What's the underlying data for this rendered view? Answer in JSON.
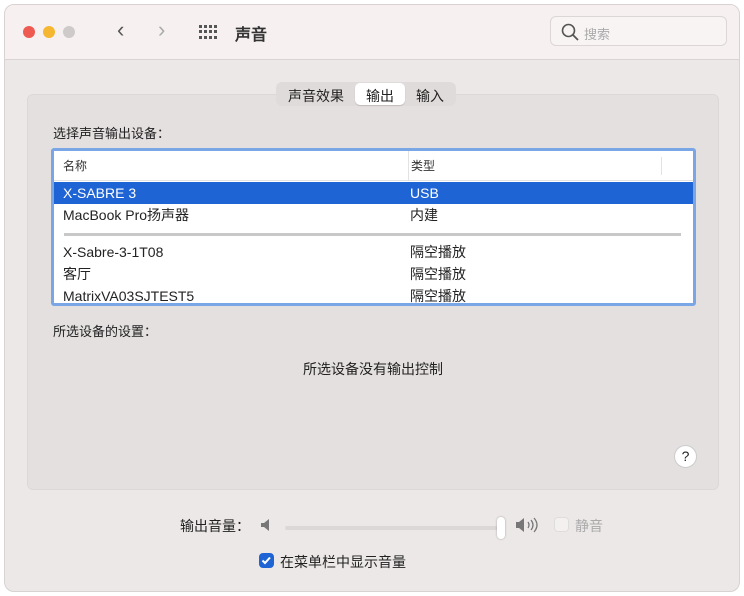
{
  "window": {
    "title": "声音",
    "search_placeholder": "搜索"
  },
  "tabs": [
    {
      "label": "声音效果",
      "selected": false
    },
    {
      "label": "输出",
      "selected": true
    },
    {
      "label": "输入",
      "selected": false
    }
  ],
  "output": {
    "section_label": "选择声音输出设备：",
    "columns": [
      "名称",
      "类型"
    ],
    "devices": [
      {
        "name": "X-SABRE 3",
        "type": "USB",
        "selected": true
      },
      {
        "name": "MacBook Pro扬声器",
        "type": "内建",
        "selected": false
      },
      {
        "name": "X-Sabre-3-1T08",
        "type": "隔空播放",
        "selected": false
      },
      {
        "name": "客厅",
        "type": "隔空播放",
        "selected": false
      },
      {
        "name": "MatrixVA03SJTEST5",
        "type": "隔空播放",
        "selected": false
      }
    ],
    "settings_label": "所选设备的设置：",
    "no_controls": "所选设备没有输出控制",
    "help": "?"
  },
  "volume": {
    "label": "输出音量：",
    "value": 1.0,
    "mute_label": "静音",
    "muted": false,
    "show_in_menubar_label": "在菜单栏中显示音量",
    "show_in_menubar": true
  },
  "colors": {
    "accent": "#1f64d4"
  }
}
